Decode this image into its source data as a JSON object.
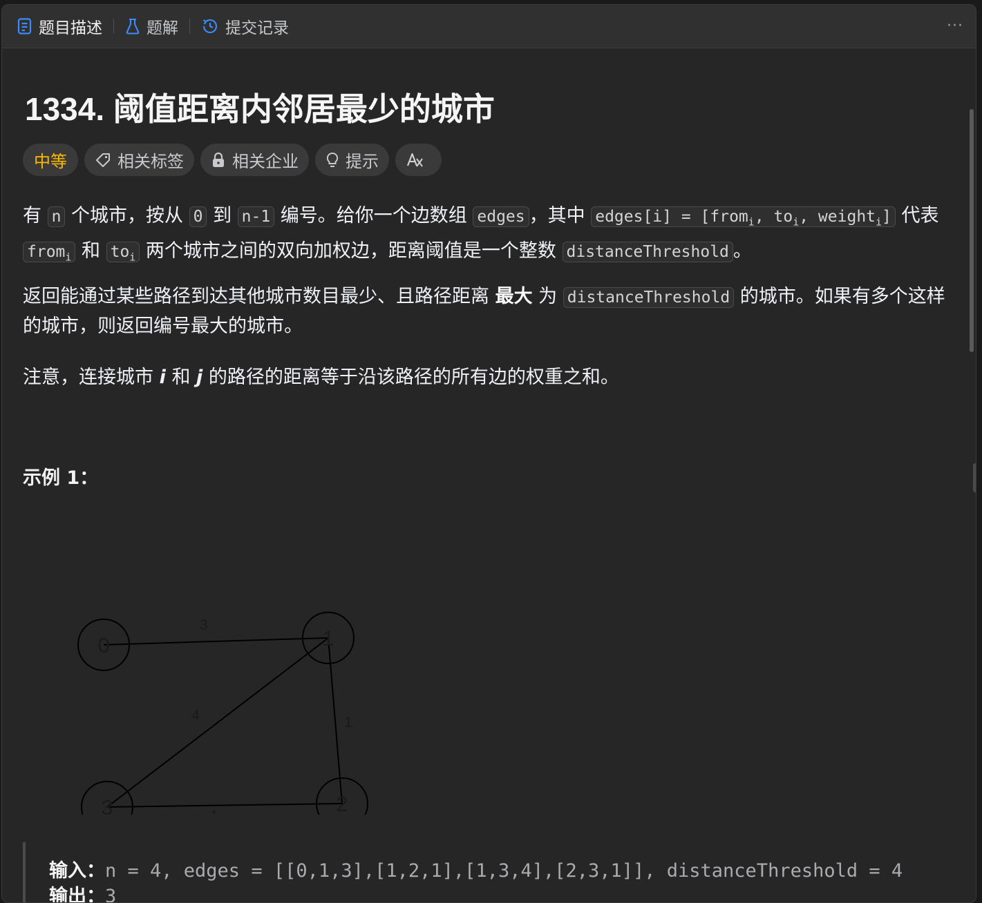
{
  "tabs": [
    {
      "label": "题目描述",
      "icon": "description-icon",
      "active": true
    },
    {
      "label": "题解",
      "icon": "flask-icon",
      "active": false
    },
    {
      "label": "提交记录",
      "icon": "history-icon",
      "active": false
    }
  ],
  "more_label": "···",
  "problem": {
    "title": "1334. 阈值距离内邻居最少的城市",
    "difficulty": "中等",
    "difficulty_color": "#ffb800",
    "chips": {
      "tags": "相关标签",
      "companies": "相关企业",
      "hint": "提示"
    }
  },
  "description": {
    "p1": {
      "t1": "有 ",
      "c_n": "n",
      "t2": " 个城市，按从 ",
      "c_0": "0",
      "t3": " 到 ",
      "c_n1": "n-1",
      "t4": " 编号。给你一个边数组 ",
      "c_edges": "edges",
      "t5": "，其中 ",
      "c_edge_a": "edges[i] = [from",
      "sub_i1": "i",
      "c_edge_b": ", to",
      "sub_i2": "i",
      "c_edge_c": ", weight",
      "sub_i3": "i",
      "c_edge_d": "]",
      "t6": " 代表 ",
      "c_from": "from",
      "sub_i4": "i",
      "t7": " 和 ",
      "c_to": "to",
      "sub_i5": "i",
      "t8": " 两个城市之间的双向加权边，距离阈值是一个整数 ",
      "c_dt": "distanceThreshold",
      "t9": "。"
    },
    "p2": {
      "t1": "返回能通过某些路径到达其他城市数目最少、且路径距离 ",
      "bold": "最大",
      "t2": " 为 ",
      "c_dt": "distanceThreshold",
      "t3": " 的城市。如果有多个这样的城市，则返回编号最大的城市。"
    },
    "p3": {
      "t1": "注意，连接城市 ",
      "var_i": "i",
      "t2": " 和 ",
      "var_j": "j",
      "t3": " 的路径的距离等于沿该路径的所有边的权重之和。"
    }
  },
  "example": {
    "title": "示例 1：",
    "graph": {
      "nodes": [
        "0",
        "1",
        "2",
        "3"
      ],
      "edges": [
        {
          "from": "0",
          "to": "1",
          "weight": "3"
        },
        {
          "from": "1",
          "to": "3",
          "weight": "4"
        },
        {
          "from": "1",
          "to": "2",
          "weight": "1"
        },
        {
          "from": "3",
          "to": "2",
          "weight": "1"
        }
      ]
    },
    "input_label": "输入：",
    "input_value": "n = 4, edges = [[0,1,3],[1,2,1],[1,3,4],[2,3,1]], distanceThreshold = 4",
    "output_label": "输出：",
    "output_value": "3"
  }
}
